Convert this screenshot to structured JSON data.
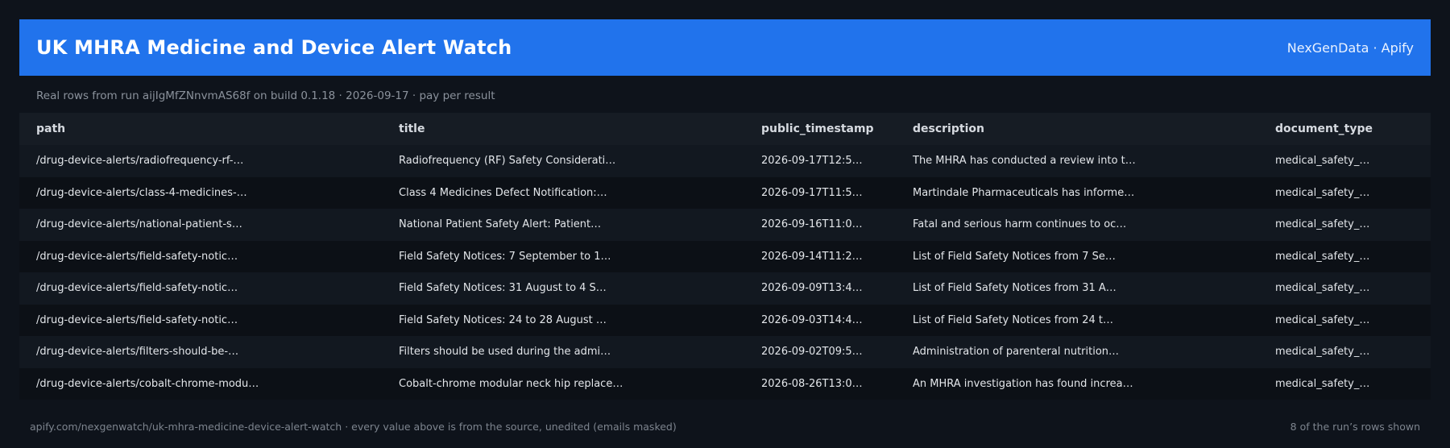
{
  "header": {
    "title": "UK MHRA Medicine and Device Alert Watch",
    "brand": "NexGenData · Apify",
    "accent_color": "#2173ec"
  },
  "subtitle": "Real rows from run aijIgMfZNnvmAS68f on build 0.1.18 · 2026-09-17 · pay per result",
  "table": {
    "columns": [
      "path",
      "title",
      "public_timestamp",
      "description",
      "document_type"
    ],
    "rows": [
      [
        "/drug-device-alerts/radiofrequency-rf-…",
        "Radiofrequency (RF) Safety Considerati…",
        "2026-09-17T12:5…",
        "The MHRA has conducted a review into t…",
        "medical_safety_…"
      ],
      [
        "/drug-device-alerts/class-4-medicines-…",
        "Class 4 Medicines Defect Notification:…",
        "2026-09-17T11:5…",
        "Martindale Pharmaceuticals has informe…",
        "medical_safety_…"
      ],
      [
        "/drug-device-alerts/national-patient-s…",
        "National Patient Safety Alert: Patient…",
        "2026-09-16T11:0…",
        "Fatal and serious harm continues to oc…",
        "medical_safety_…"
      ],
      [
        "/drug-device-alerts/field-safety-notic…",
        "Field Safety Notices: 7 September to 1…",
        "2026-09-14T11:2…",
        "List of Field Safety Notices from 7 Se…",
        "medical_safety_…"
      ],
      [
        "/drug-device-alerts/field-safety-notic…",
        "Field Safety Notices: 31 August to 4 S…",
        "2026-09-09T13:4…",
        "List of Field Safety Notices from 31 A…",
        "medical_safety_…"
      ],
      [
        "/drug-device-alerts/field-safety-notic…",
        "Field Safety Notices: 24 to 28 August …",
        "2026-09-03T14:4…",
        "List of Field Safety Notices from 24 t…",
        "medical_safety_…"
      ],
      [
        "/drug-device-alerts/filters-should-be-…",
        "Filters should be used during the admi…",
        "2026-09-02T09:5…",
        "Administration of parenteral nutrition…",
        "medical_safety_…"
      ],
      [
        "/drug-device-alerts/cobalt-chrome-modu…",
        "Cobalt-chrome modular neck hip replace…",
        "2026-08-26T13:0…",
        "An MHRA investigation has found increa…",
        "medical_safety_…"
      ]
    ]
  },
  "footer": {
    "source": "apify.com/nexgenwatch/uk-mhra-medicine-device-alert-watch  ·  every value above is from the source, unedited (emails masked)",
    "count": "8 of the run’s rows shown"
  }
}
